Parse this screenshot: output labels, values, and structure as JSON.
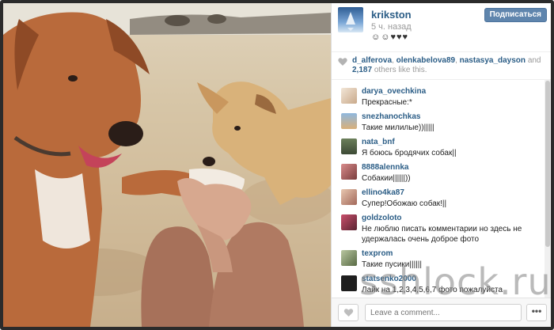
{
  "post": {
    "username": "krikston",
    "time_ago": "5 ч. назад",
    "caption": "☺☺♥♥♥",
    "follow_label": "Подписаться"
  },
  "likes": {
    "users": [
      "d_alferova",
      "olenkabelova89",
      "nastasya_dayson"
    ],
    "and_word": "and",
    "count": "2,187",
    "suffix": "others like this."
  },
  "comments": [
    {
      "user": "darya_ovechkina",
      "text": "Прекрасные:*"
    },
    {
      "user": "snezhanochkas",
      "text": "Такие милилые))|||||"
    },
    {
      "user": "nata_bnf",
      "text": "Я боюсь бродячих собак||"
    },
    {
      "user": "8888alennka",
      "text": "Собакии||||||))"
    },
    {
      "user": "ellino4ka87",
      "text": "Супер!Обожаю собак!||"
    },
    {
      "user": "goldzoloto",
      "text": "Не люблю писать комментарии но здесь не удержалась очень доброе фото"
    },
    {
      "user": "texprom",
      "text": "Такие пусики||||||"
    },
    {
      "user": "statsenko2000",
      "text": "Лайк на 1,2,3,4,5,6,7 фото пожалуйста"
    }
  ],
  "footer": {
    "comment_placeholder": "Leave a comment...",
    "more_label": "•••"
  },
  "watermark": "sshlock.ru",
  "icons": {
    "like": "heart-icon",
    "more": "ellipsis-icon"
  },
  "colors": {
    "link": "#2b5d86",
    "follow_button": "#5f85ad",
    "frame": "#2b2b2b"
  }
}
